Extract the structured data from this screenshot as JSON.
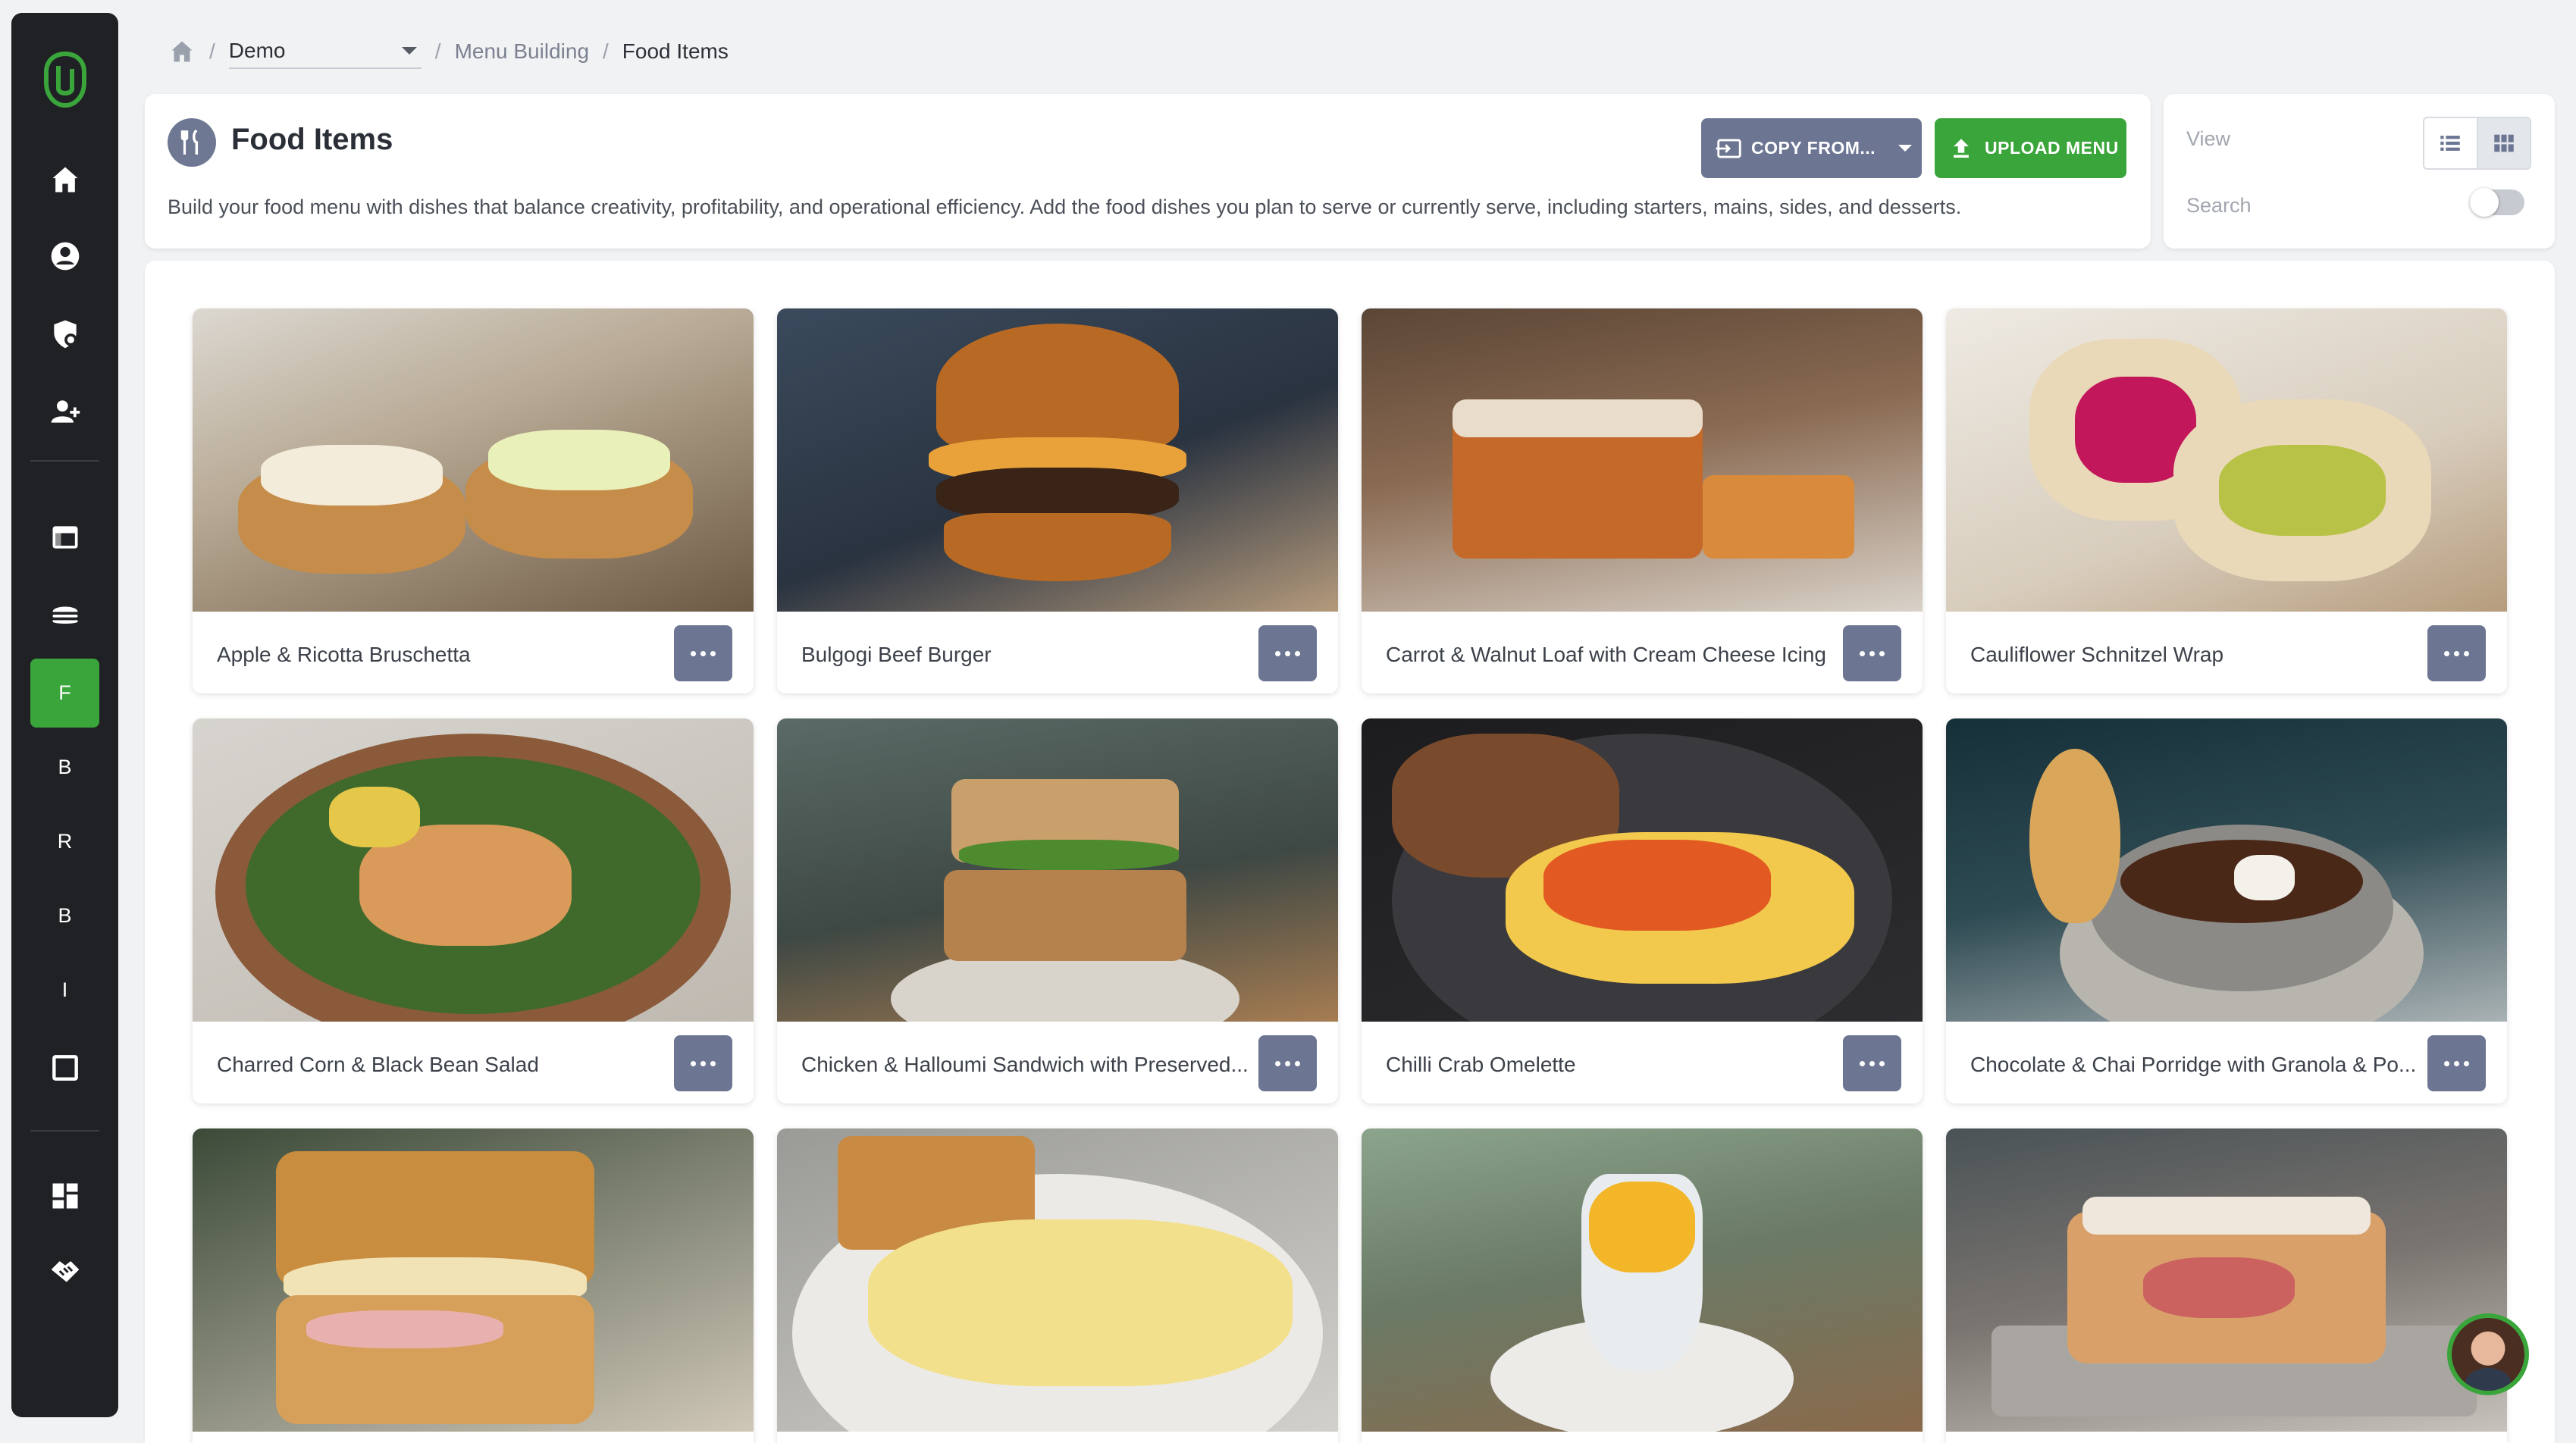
{
  "breadcrumb": {
    "workspace": "Demo",
    "section": "Menu Building",
    "current": "Food Items"
  },
  "sidebar": {
    "items": [
      {
        "name": "home-icon",
        "letter": ""
      },
      {
        "name": "account-icon",
        "letter": ""
      },
      {
        "name": "security-settings-icon",
        "letter": ""
      },
      {
        "name": "add-user-icon",
        "letter": ""
      },
      {
        "name": "web-page-icon",
        "letter": ""
      },
      {
        "name": "burger-icon",
        "letter": ""
      },
      {
        "name": "sidebar-item-f",
        "letter": "F"
      },
      {
        "name": "sidebar-item-b1",
        "letter": "B"
      },
      {
        "name": "sidebar-item-r",
        "letter": "R"
      },
      {
        "name": "sidebar-item-b2",
        "letter": "B"
      },
      {
        "name": "sidebar-item-i",
        "letter": "I"
      },
      {
        "name": "square-icon",
        "letter": ""
      },
      {
        "name": "dashboard-icon",
        "letter": ""
      },
      {
        "name": "handshake-icon",
        "letter": ""
      }
    ],
    "accent": "#3aa53a"
  },
  "header": {
    "title": "Food Items",
    "description": "Build your food menu with dishes that balance creativity, profitability, and operational efficiency. Add the food dishes you plan to serve or currently serve, including starters, mains, sides, and desserts.",
    "copy_label": "COPY FROM...",
    "upload_label": "UPLOAD MENU"
  },
  "view_panel": {
    "view_label": "View",
    "search_label": "Search",
    "active_view": "grid",
    "search_toggle": false
  },
  "colors": {
    "primary_green": "#3aa53a",
    "slate_button": "#6c7693",
    "sidebar_bg": "#1f2125"
  },
  "items": [
    {
      "name": "Apple & Ricotta Bruschetta"
    },
    {
      "name": "Bulgogi Beef Burger"
    },
    {
      "name": "Carrot & Walnut Loaf with Cream Cheese Icing"
    },
    {
      "name": "Cauliflower Schnitzel Wrap"
    },
    {
      "name": "Charred Corn & Black Bean Salad"
    },
    {
      "name": "Chicken & Halloumi Sandwich with Preserved..."
    },
    {
      "name": "Chilli Crab Omelette"
    },
    {
      "name": "Chocolate & Chai Porridge with Granola & Po..."
    },
    {
      "name": ""
    },
    {
      "name": ""
    },
    {
      "name": ""
    },
    {
      "name": ""
    }
  ]
}
